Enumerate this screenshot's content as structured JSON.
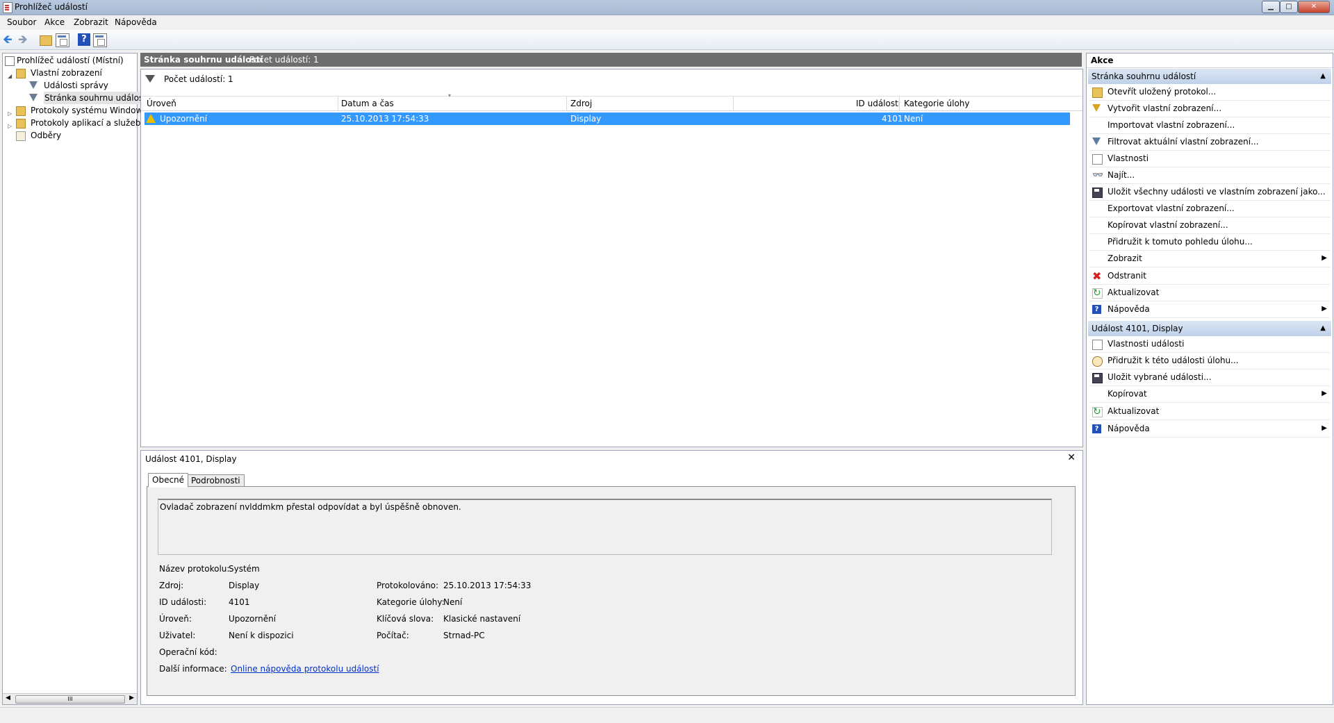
{
  "window": {
    "title": "Prohlížeč událostí",
    "min": "▁",
    "max": "□",
    "close": "✕"
  },
  "menu": [
    "Soubor",
    "Akce",
    "Zobrazit",
    "Nápověda"
  ],
  "toolbar": {
    "back": "🡸",
    "forward": "🡺",
    "help": "?"
  },
  "tree": {
    "root": "Prohlížeč událostí (Místní)",
    "custom_views": "Vlastní zobrazení",
    "admin_events": "Události správy",
    "summary_page": "Stránka souhrnu událostí",
    "windows_logs": "Protokoly systému Windows",
    "app_logs": "Protokoly aplikací a služeb",
    "subscriptions": "Odběry",
    "scroll_grip": "III"
  },
  "main": {
    "header_title": "Stránka souhrnu událostí",
    "header_count": "Počet událostí: 1",
    "filter_text": "Počet událostí: 1",
    "columns": [
      "Úroveň",
      "Datum a čas",
      "Zdroj",
      "ID události",
      "Kategorie úlohy"
    ],
    "rows": [
      {
        "level": "Upozornění",
        "datetime": "25.10.2013 17:54:33",
        "source": "Display",
        "id": "4101",
        "category": "Není"
      }
    ]
  },
  "detail": {
    "title": "Událost 4101, Display",
    "close": "✕",
    "tabs": [
      "Obecné",
      "Podrobnosti"
    ],
    "message": "Ovladač zobrazení nvlddmkm přestal odpovídat a byl úspěšně obnoven.",
    "labels": {
      "log_name": "Název protokolu:",
      "source": "Zdroj:",
      "event_id": "ID události:",
      "level": "Úroveň:",
      "user": "Uživatel:",
      "opcode": "Operační kód:",
      "more_info": "Další informace:",
      "logged": "Protokolováno:",
      "task_category": "Kategorie úlohy:",
      "keywords": "Klíčová slova:",
      "computer": "Počítač:"
    },
    "values": {
      "log_name": "Systém",
      "source": "Display",
      "event_id": "4101",
      "level": "Upozornění",
      "user": "Není k dispozici",
      "opcode": "",
      "more_info_link": "Online nápověda protokolu událostí",
      "logged": "25.10.2013 17:54:33",
      "task_category": "Není",
      "keywords": "Klasické nastavení",
      "computer": "Strnad-PC"
    }
  },
  "actions": {
    "title": "Akce",
    "section1": "Stránka souhrnu událostí",
    "items1": [
      "Otevřít uložený protokol...",
      "Vytvořit vlastní zobrazení...",
      "Importovat vlastní zobrazení...",
      "Filtrovat aktuální vlastní zobrazení...",
      "Vlastnosti",
      "Najít...",
      "Uložit všechny události ve vlastním zobrazení jako...",
      "Exportovat vlastní zobrazení...",
      "Kopírovat vlastní zobrazení...",
      "Přidružit k tomuto pohledu úlohu...",
      "Zobrazit",
      "Odstranit",
      "Aktualizovat",
      "Nápověda"
    ],
    "section2": "Událost 4101, Display",
    "items2": [
      "Vlastnosti události",
      "Přidružit k této události úlohu...",
      "Uložit vybrané události...",
      "Kopírovat",
      "Aktualizovat",
      "Nápověda"
    ],
    "collapse": "▲",
    "submenu": "▶"
  },
  "colors": {
    "selection": "#3399ff",
    "section_header": "#c9d9ee",
    "panel_header": "#6d6d6d",
    "link": "#0033cc"
  }
}
